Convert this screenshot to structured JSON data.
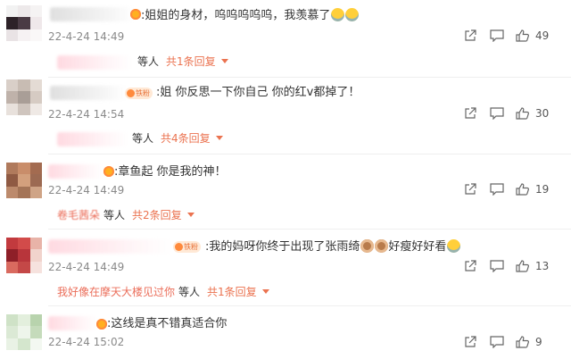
{
  "comments": [
    {
      "text": ":姐姐的身材，呜呜呜呜呜，我羡慕了",
      "time": "22-4-24 14:49",
      "likes": "49",
      "reply": {
        "replier": "",
        "deng": "等人",
        "count": "共1条回复"
      },
      "avatar_colors": [
        "#f2f2f2",
        "#ede9ea",
        "#f5f3f3",
        "#2d2228",
        "#4a3b44",
        "#efe8ea",
        "#e9e3e5",
        "#f6f2f3",
        "#faf8f8"
      ],
      "badge": "",
      "emoji": [
        "crying-emoji",
        "crying-emoji"
      ]
    },
    {
      "text": ":姐 你反思一下你自己 你的红v都掉了！",
      "time": "22-4-24 14:54",
      "likes": "30",
      "reply": {
        "replier": "",
        "deng": "等人",
        "count": "共4条回复"
      },
      "avatar_colors": [
        "#d9cfc8",
        "#c8bcb3",
        "#e4dbd4",
        "#bfb2aa",
        "#a99e97",
        "#d6cbc3",
        "#e8e1dc",
        "#cfc5be",
        "#efe9e5"
      ],
      "badge": "铁粉",
      "emoji": []
    },
    {
      "text": ":章鱼起 你是我的神！",
      "time": "22-4-24 14:49",
      "likes": "19",
      "reply": {
        "replier": "卷毛茜朵",
        "deng": "等人",
        "count": "共2条回复"
      },
      "avatar_colors": [
        "#b07a5c",
        "#c98d6a",
        "#a36b50",
        "#8f5a43",
        "#d3a07d",
        "#9c6a52",
        "#bc8a6c",
        "#a47457",
        "#cfa486"
      ],
      "badge": "",
      "emoji": []
    },
    {
      "text": ":我的妈呀你终于出现了张雨绮",
      "text2": "好瘦好好看",
      "time": "22-4-24 14:49",
      "likes": "13",
      "reply": {
        "replier": "我好像在摩天大楼见过你",
        "deng": "等人",
        "count": "共1条回复"
      },
      "avatar_colors": [
        "#c23a3e",
        "#d24b4a",
        "#e8b3a8",
        "#8e1f28",
        "#b8353b",
        "#f1d3cc",
        "#d96a5f",
        "#c44847",
        "#f6e2de"
      ],
      "badge": "铁粉",
      "emoji": [
        "monkey-emoji",
        "monkey-emoji",
        "tear-emoji"
      ]
    },
    {
      "text": ":这线是真不错真适合你",
      "time": "22-4-24 15:02",
      "likes": "9",
      "reply": null,
      "avatar_colors": [
        "#cfe2c7",
        "#e3efdd",
        "#b8d3ad",
        "#dbe9d5",
        "#eef5eb",
        "#c5dbbb",
        "#e9f2e5",
        "#d4e6cd",
        "#f3f8f1"
      ],
      "badge": "",
      "emoji": []
    }
  ],
  "icons": {
    "share": "share-icon",
    "comment": "comment-icon",
    "like": "thumbs-up-icon"
  },
  "colors": {
    "reply_accent": "#eb7350",
    "time_gray": "#8a8a8a",
    "badge_orange": "#ff8a3c"
  }
}
